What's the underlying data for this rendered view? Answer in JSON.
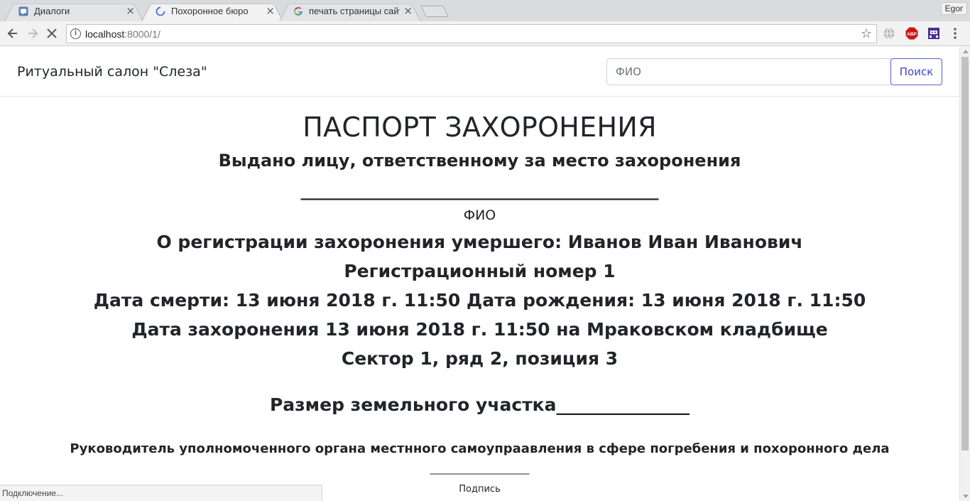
{
  "browser": {
    "tabs": [
      {
        "title": "Диалоги",
        "icon": "dialog-icon",
        "close": "×"
      },
      {
        "title": "Похоронное бюро",
        "icon": "loading-spinner-icon",
        "close": "×"
      },
      {
        "title": "печать страницы сайт",
        "icon": "google-g-icon",
        "close": "×"
      }
    ],
    "profile_name": "Egor",
    "url_host": "localhost",
    "url_rest": ":8000/1/",
    "status_text": "Подключение..."
  },
  "site": {
    "brand": "Ритуальный салон \"Слеза\"",
    "search": {
      "placeholder": "ФИО",
      "button_label": "Поиск"
    }
  },
  "document": {
    "title": "ПАСПОРТ ЗАХОРОНЕНИЯ",
    "issued_to": "Выдано лицу, ответственному за место захоронения",
    "blank_line": "__________________________________________",
    "fio_caption": "ФИО",
    "registration": "О регистрации захоронения умершего: Иванов Иван Иванович",
    "registration_number": "Регистрационный номер 1",
    "dates": "Дата смерти: 13 июня 2018 г. 11:50 Дата рождения: 13 июня 2018 г. 11:50",
    "burial": "Дата захоронения 13 июня 2018 г. 11:50 на Мраковском кладбище",
    "sector": "Сектор 1, ряд 2, позиция 3",
    "plot_size": "Размер земельного участка_______________",
    "head": "Руководитель уполномоченного органа местнного самоупраавления в сфере погребения и похоронного дела",
    "signature_line": "____________________",
    "signature_caption": "Подпись"
  }
}
